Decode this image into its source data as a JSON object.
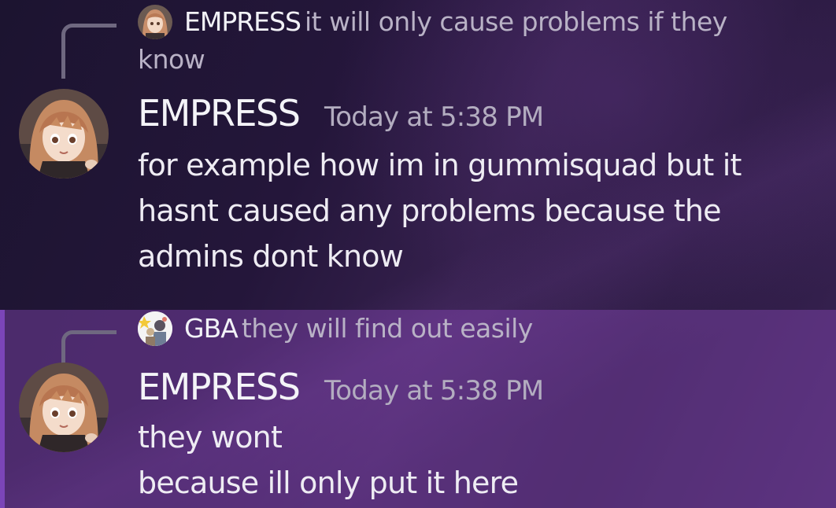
{
  "messages": [
    {
      "reply": {
        "author": "EMPRESS",
        "text_line1": "it will only cause problems if they",
        "text_line2": "know",
        "avatar_icon": "anime-girl-avatar"
      },
      "author": "EMPRESS",
      "timestamp": "Today at 5:38 PM",
      "lines": [
        "for example how im in gummisquad but it",
        "hasnt caused any problems because the",
        "admins dont know"
      ],
      "avatar_icon": "anime-girl-avatar"
    },
    {
      "reply": {
        "author": "GBA",
        "text": "they will find out easily",
        "avatar_icon": "anime-characters-avatar"
      },
      "author": "EMPRESS",
      "timestamp": "Today at 5:38 PM",
      "lines": [
        "they wont",
        "because ill only put it here"
      ],
      "avatar_icon": "anime-girl-avatar",
      "highlighted": true
    }
  ],
  "colors": {
    "highlight_bar": "#7b45b8",
    "author": "#f4f4f8",
    "timestamp": "#b3adc0",
    "body": "#eeecf3"
  }
}
